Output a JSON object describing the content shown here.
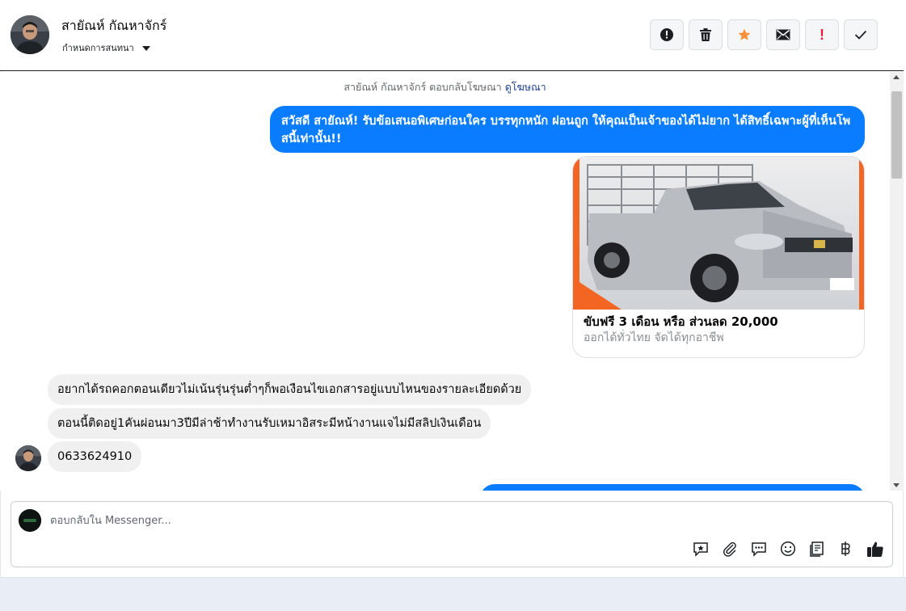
{
  "header": {
    "name": "สายัณห์ กัณหาจักร์",
    "subtitle": "กำหนดการสนทนา"
  },
  "toolbar": {
    "actions": [
      {
        "icon": "alert-circle-icon",
        "label": ""
      },
      {
        "icon": "trash-icon",
        "label": ""
      },
      {
        "icon": "star-icon",
        "label": ""
      },
      {
        "icon": "mail-icon",
        "label": ""
      },
      {
        "icon": "exclamation-icon",
        "label": "!"
      },
      {
        "icon": "check-icon",
        "label": ""
      }
    ],
    "star_color": "#f7923a",
    "exclamation_color": "#e41e3f"
  },
  "chat": {
    "reply_note": "สายัณห์ กัณหาจักร์ ตอบกลับโฆษณา",
    "reply_link": "ดูโฆษณา",
    "outgoing_message": "สวัสดี สายัณห์! รับข้อเสนอพิเศษก่อนใคร บรรทุกหนัก ผ่อนถูก ให้คุณเป็นเจ้าของได้ไม่ยาก ได้สิทธิ์เฉพาะผู้ที่เห็นโพสนี้เท่านั้น!!",
    "ad": {
      "title": "ขับฟรี 3 เดือน หรือ ส่วนลด 20,000",
      "subtitle": "ออกได้ทั่วไทย จัดได้ทุกอาชีพ"
    },
    "incoming_messages": [
      "อยากได้รถคอกตอนเดียวไม่เน้นรุ่นรุ่นต่ำๆก็พอเงือนไขเอกสารอยู่แบบไหนของรายละเอียดด้วย",
      "ตอนนี้ติดอยู่1คันผ่อนมา3ปีมีล่าช้าทำงานรับเหมาอิสระมีหน้างานแจไม่มีสลิปเงินเดือน",
      "0633624910"
    ]
  },
  "composer": {
    "placeholder": "ตอบกลับใน Messenger...",
    "value": "",
    "tools": [
      "saved-reply-icon",
      "attachment-icon",
      "chat-bubble-icon",
      "emoji-icon",
      "catalog-icon",
      "baht-icon",
      "thumbs-up-icon"
    ]
  },
  "colors": {
    "accent": "#0a7cff",
    "incoming_bubble": "#f0f0f0"
  }
}
